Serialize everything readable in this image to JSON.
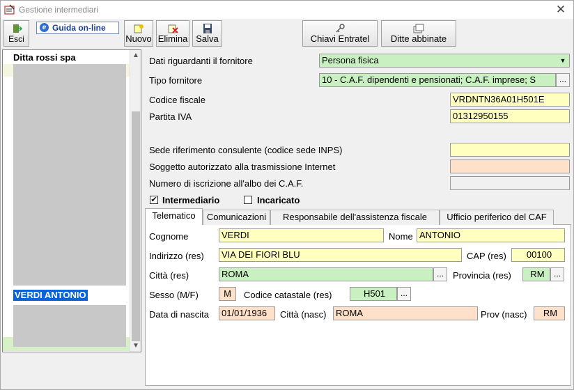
{
  "window": {
    "title": "Gestione intermediari",
    "icon": "app-form-icon"
  },
  "toolbar": {
    "esci": "Esci",
    "guida": "Guida on-line",
    "nuovo": "Nuovo",
    "elimina": "Elimina",
    "salva": "Salva",
    "chiavi": "Chiavi Entratel",
    "ditte": "Ditte abbinate"
  },
  "list": {
    "header": "Ditta rossi spa",
    "selected": "VERDI ANTONIO"
  },
  "fornitore": {
    "dati_label": "Dati riguardanti il fornitore",
    "dati_value": "Persona fisica",
    "tipo_label": "Tipo fornitore",
    "tipo_value": "10 - C.A.F. dipendenti e pensionati; C.A.F. imprese; S",
    "cf_label": "Codice fiscale",
    "cf_value": "VRDNTN36A01H501E",
    "piva_label": "Partita IVA",
    "piva_value": "01312950155",
    "sede_label": "Sede riferimento consulente (codice sede INPS)",
    "sede_value": "",
    "soggetto_label": "Soggetto autorizzato alla trasmissione Internet",
    "soggetto_value": "",
    "albo_label": "Numero di iscrizione all'albo dei C.A.F.",
    "albo_value": "",
    "intermediario_label": "Intermediario",
    "intermediario_checked": "✔",
    "incaricato_label": "Incaricato"
  },
  "tabs": [
    "Telematico",
    "Comunicazioni",
    "Responsabile dell'assistenza fiscale",
    "Ufficio periferico del CAF"
  ],
  "telematico": {
    "cognome_label": "Cognome",
    "cognome": "VERDI",
    "nome_label": "Nome",
    "nome": "ANTONIO",
    "indirizzo_label": "Indirizzo (res)",
    "indirizzo": "VIA DEI FIORI BLU",
    "cap_label": "CAP (res)",
    "cap": "00100",
    "citta_label": "Città (res)",
    "citta": "ROMA",
    "provincia_label": "Provincia (res)",
    "provincia": "RM",
    "sesso_label": "Sesso (M/F)",
    "sesso": "M",
    "catastale_label": "Codice catastale (res)",
    "catastale": "H501",
    "nascita_label": "Data di nascita",
    "nascita": "01/01/1936",
    "citta_nasc_label": "Città (nasc)",
    "citta_nasc": "ROMA",
    "prov_nasc_label": "Prov (nasc)",
    "prov_nasc": "RM"
  },
  "colors": {
    "yellow": "#ffffc0",
    "green": "#c8f0c0",
    "salmon": "#ffe0c8",
    "selection": "#0a64d8"
  }
}
